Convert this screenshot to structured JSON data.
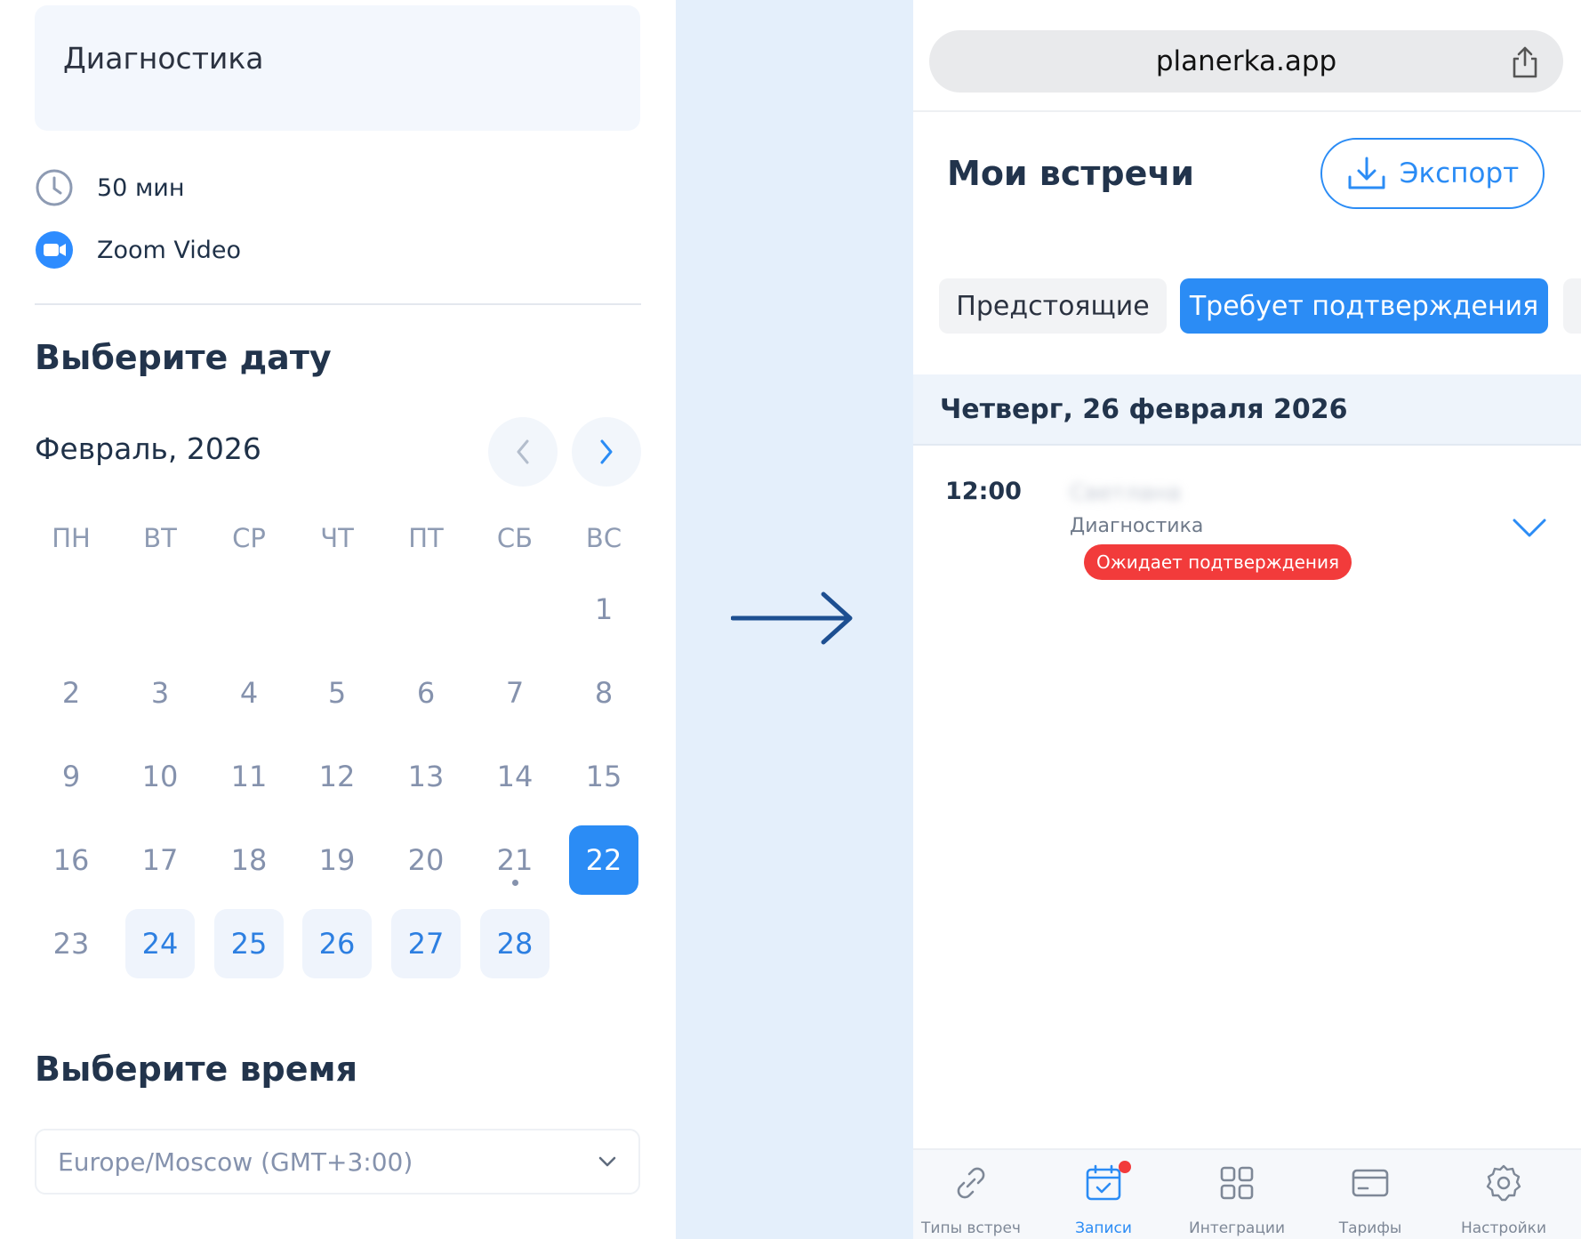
{
  "left": {
    "event_name": "Диагностика",
    "duration": "50 мин",
    "location": "Zoom Video",
    "date_section_title": "Выберите дату",
    "month_label": "Февраль, 2026",
    "weekdays": [
      "ПН",
      "ВТ",
      "СР",
      "ЧТ",
      "ПТ",
      "СБ",
      "ВС"
    ],
    "days": [
      "1",
      "2",
      "3",
      "4",
      "5",
      "6",
      "7",
      "8",
      "9",
      "10",
      "11",
      "12",
      "13",
      "14",
      "15",
      "16",
      "17",
      "18",
      "19",
      "20",
      "21",
      "22",
      "23",
      "24",
      "25",
      "26",
      "27",
      "28"
    ],
    "today": "21",
    "selected_day": "22",
    "available_days": [
      "24",
      "25",
      "26",
      "27",
      "28"
    ],
    "time_section_title": "Выберите время",
    "timezone": "Europe/Moscow (GMT+3:00)"
  },
  "right": {
    "url": "planerka.app",
    "page_title": "Мои встречи",
    "export_label": "Экспорт",
    "tabs": [
      "Предстоящие",
      "Требует подтверждения"
    ],
    "active_tab": "Требует подтверждения",
    "date_header": "Четверг, 26 февраля 2026",
    "meeting": {
      "time": "12:00",
      "name": "Светлана",
      "type": "Диагностика",
      "status": "Ожидает подтверждения"
    },
    "bottom_nav": [
      "Типы встреч",
      "Записи",
      "Интеграции",
      "Тарифы",
      "Настройки"
    ],
    "active_nav": "Записи"
  },
  "colors": {
    "accent": "#2b8cf5",
    "status_red": "#f23b3b",
    "canvas": "#e4effb",
    "arrow": "#1d4f91"
  },
  "icons": [
    "clock-icon",
    "zoom-icon",
    "chevron-left-icon",
    "chevron-right-icon",
    "chevron-down-icon",
    "arrow-right-icon",
    "share-icon",
    "download-icon",
    "link-icon",
    "calendar-check-icon",
    "grid-icon",
    "card-icon",
    "gear-icon"
  ]
}
